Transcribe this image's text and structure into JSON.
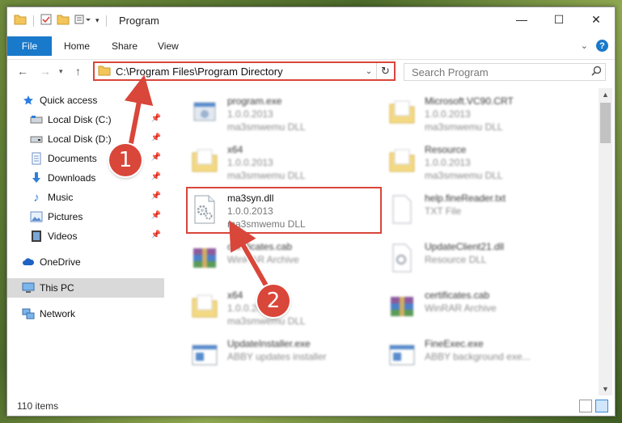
{
  "window": {
    "title": "Program"
  },
  "ribbon": {
    "file_label": "File",
    "tabs": [
      "Home",
      "Share",
      "View"
    ]
  },
  "address": {
    "path": "C:\\Program Files\\Program Directory"
  },
  "search": {
    "placeholder": "Search Program"
  },
  "sidebar": {
    "items": [
      {
        "label": "Quick access",
        "icon": "star-icon",
        "pinned": false
      },
      {
        "label": "Local Disk (C:)",
        "icon": "drive-icon",
        "pinned": true
      },
      {
        "label": "Local Disk (D:)",
        "icon": "drive-icon",
        "pinned": true
      },
      {
        "label": "Documents",
        "icon": "documents-icon",
        "pinned": true
      },
      {
        "label": "Downloads",
        "icon": "download-icon",
        "pinned": true
      },
      {
        "label": "Music",
        "icon": "music-icon",
        "pinned": true
      },
      {
        "label": "Pictures",
        "icon": "pictures-icon",
        "pinned": true
      },
      {
        "label": "Videos",
        "icon": "videos-icon",
        "pinned": true
      },
      {
        "label": "OneDrive",
        "icon": "cloud-icon",
        "pinned": false
      },
      {
        "label": "This PC",
        "icon": "computer-icon",
        "pinned": false,
        "selected": true
      },
      {
        "label": "Network",
        "icon": "network-icon",
        "pinned": false
      }
    ]
  },
  "files": [
    {
      "name": "program.exe",
      "line2": "1.0.0.2013",
      "line3": "ma3smwemu DLL",
      "icon": "exe-icon"
    },
    {
      "name": "Microsoft.VC90.CRT",
      "line2": "1.0.0.2013",
      "line3": "ma3smwemu DLL",
      "icon": "folder-icon"
    },
    {
      "name": "x64",
      "line2": "1.0.0.2013",
      "line3": "ma3smwemu DLL",
      "icon": "folder-icon"
    },
    {
      "name": "Resource",
      "line2": "1.0.0.2013",
      "line3": "ma3smwemu DLL",
      "icon": "folder-icon"
    },
    {
      "name": "ma3syn.dll",
      "line2": "1.0.0.2013",
      "line3": "ma3smwemu DLL",
      "icon": "dll-gear-icon"
    },
    {
      "name": "help.fineReader.txt",
      "line2": "TXT File",
      "line3": "",
      "icon": "text-file-icon"
    },
    {
      "name": "certificates.cab",
      "line2": "WinRAR Archive",
      "line3": "",
      "icon": "archive-icon"
    },
    {
      "name": "UpdateClient21.dll",
      "line2": "Resource DLL",
      "line3": "",
      "icon": "dll-gear-icon"
    },
    {
      "name": "x64",
      "line2": "1.0.0.2013",
      "line3": "ma3smwemu DLL",
      "icon": "folder-icon"
    },
    {
      "name": "certificates.cab",
      "line2": "WinRAR Archive",
      "line3": "",
      "icon": "archive-icon"
    },
    {
      "name": "UpdateInstaller.exe",
      "line2": "ABBY updates installer",
      "line3": "",
      "icon": "app-window-icon"
    },
    {
      "name": "FineExec.exe",
      "line2": "ABBY background exe...",
      "line3": "",
      "icon": "app-window-icon"
    }
  ],
  "status": {
    "count": "110 items"
  },
  "annotations": {
    "step1": "1",
    "step2": "2"
  },
  "colors": {
    "accent": "#1979ca",
    "highlight": "#d9463a"
  }
}
